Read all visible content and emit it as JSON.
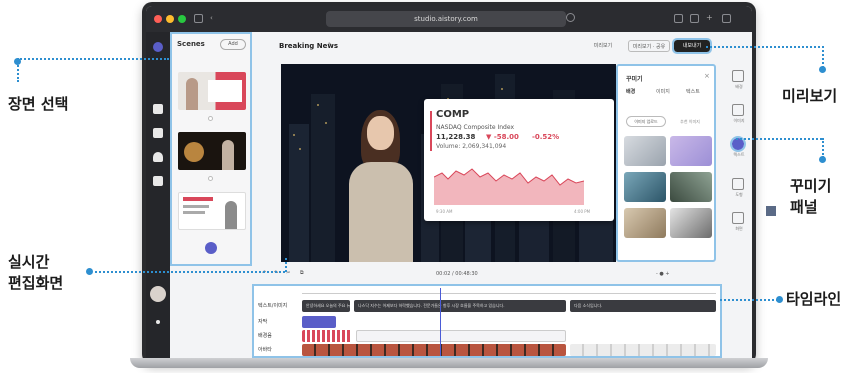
{
  "callouts": {
    "scene_select": "장면 선택",
    "preview": "미리보기",
    "decorate_panel_line1": "꾸미기",
    "decorate_panel_line2": "패널",
    "realtime_edit_line1": "실시간",
    "realtime_edit_line2": "편집화면",
    "timeline": "타임라인"
  },
  "browser": {
    "url": "studio.aistory.com"
  },
  "scenes_panel": {
    "title": "Scenes",
    "add_label": "Add"
  },
  "editor": {
    "project_title": "Breaking News",
    "btn_left": "미리보기",
    "btn_mid": "미리보기 · 공유",
    "btn_right": "내보내기"
  },
  "stock_card": {
    "ticker": "COMP",
    "name": "NASDAQ Composite Index",
    "price": "11,228.38",
    "change": "▼ -58.00",
    "change_pct": "-0.52%",
    "volume": "Volume: 2,069,341,094",
    "x_start": "9:30 AM",
    "x_end": "4:00 PM"
  },
  "deco_panel": {
    "title": "꾸미기",
    "tabs": [
      "배경",
      "이미지",
      "텍스트"
    ],
    "pill1": "이미지 업로드",
    "pill2": "추천 이미지"
  },
  "right_rail": {
    "items": [
      "배경",
      "이미지",
      "텍스트",
      "도형",
      "화면"
    ]
  },
  "timeline": {
    "timecode": "00:02 / 00:48:30",
    "zoom": "- ● +",
    "tracks": [
      "텍스트/이미지",
      "자막",
      "배경음",
      "아바타"
    ],
    "subtitle_clips": [
      "안녕하세요 오늘의 주요 뉴스입니다.",
      "나스닥 지수는 어제보다 하락했습니다. 전문가들은 향후 시장 흐름을 주목하고 있습니다.",
      "다음 소식입니다."
    ]
  }
}
